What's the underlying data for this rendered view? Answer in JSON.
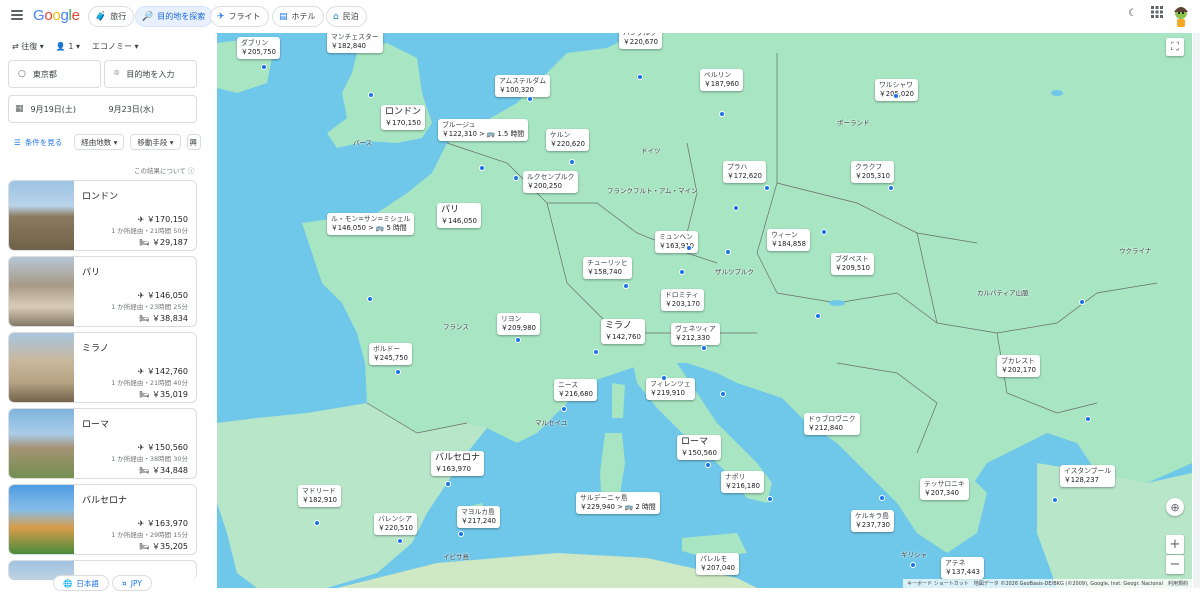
{
  "header": {
    "logo": "Google",
    "tabs": [
      {
        "label": "旅行",
        "icon": "suitcase-icon"
      },
      {
        "label": "目的地を探索",
        "icon": "explore-icon",
        "selected": true
      },
      {
        "label": "フライト",
        "icon": "plane-icon"
      },
      {
        "label": "ホテル",
        "icon": "hotel-icon"
      },
      {
        "label": "民泊",
        "icon": "house-icon"
      }
    ]
  },
  "search": {
    "trip_type": "往復",
    "passengers": "1",
    "cabin": "エコノミー",
    "origin": "東京都",
    "destination_placeholder": "目的地を入力",
    "depart": "9月19日(土)",
    "return": "9月23日(水)"
  },
  "filters": {
    "show_filters": "条件を見る",
    "stops": "経由地数",
    "transport": "移動手段",
    "interests": "興"
  },
  "about_results": "この結果について",
  "results": [
    {
      "name": "ロンドン",
      "flight": "￥170,150",
      "flight_detail": "1 か所経由・21時間 50分",
      "hotel": "￥29,187"
    },
    {
      "name": "パリ",
      "flight": "￥146,050",
      "flight_detail": "1 か所経由・23時間 25分",
      "hotel": "￥38,834"
    },
    {
      "name": "ミラノ",
      "flight": "￥142,760",
      "flight_detail": "1 か所経由・21時間 40分",
      "hotel": "￥35,019"
    },
    {
      "name": "ローマ",
      "flight": "￥150,560",
      "flight_detail": "1 か所経由・38時間 30分",
      "hotel": "￥34,848"
    },
    {
      "name": "バルセロナ",
      "flight": "￥163,970",
      "flight_detail": "1 か所経由・29時間 15分",
      "hotel": "￥35,205"
    }
  ],
  "footer": {
    "language": "日本語",
    "currency": "JPY"
  },
  "map": {
    "cities": [
      {
        "name": "ダブリン",
        "price": "￥205,750"
      },
      {
        "name": "マンチェスター",
        "price": "￥182,840"
      },
      {
        "name": "ハンブルク",
        "price": "￥220,670"
      },
      {
        "name": "アムステルダム",
        "price": "￥100,320"
      },
      {
        "name": "ベルリン",
        "price": "￥187,960"
      },
      {
        "name": "ワルシャワ",
        "price": "￥205,020"
      },
      {
        "name": "ロンドン",
        "price": "￥170,150",
        "big": true
      },
      {
        "name": "ブルージュ",
        "price": "￥122,310 > 🚌 1.5 時間"
      },
      {
        "name": "ケルン",
        "price": "￥220,620"
      },
      {
        "name": "プラハ",
        "price": "￥172,620"
      },
      {
        "name": "クラクフ",
        "price": "￥205,310"
      },
      {
        "name": "ルクセンブルク",
        "price": "￥200,250"
      },
      {
        "name": "パリ",
        "price": "￥146,050",
        "big": true
      },
      {
        "name": "ル・モン=サン=ミシェル",
        "price": "￥146,050 > 🚌 5 時間"
      },
      {
        "name": "ミュンヘン",
        "price": "￥163,910"
      },
      {
        "name": "ウィーン",
        "price": "￥184,858"
      },
      {
        "name": "ブダペスト",
        "price": "￥209,510"
      },
      {
        "name": "チューリッヒ",
        "price": "￥158,740"
      },
      {
        "name": "ドロミティ",
        "price": "￥203,170"
      },
      {
        "name": "リヨン",
        "price": "￥209,980"
      },
      {
        "name": "ミラノ",
        "price": "￥142,760",
        "big": true
      },
      {
        "name": "ヴェネツィア",
        "price": "￥212,330"
      },
      {
        "name": "ボルドー",
        "price": "￥245,750"
      },
      {
        "name": "ニース",
        "price": "￥216,680"
      },
      {
        "name": "フィレンツェ",
        "price": "￥219,910"
      },
      {
        "name": "ブカレスト",
        "price": "￥202,170"
      },
      {
        "name": "ドゥブロヴニク",
        "price": "￥212,840"
      },
      {
        "name": "ローマ",
        "price": "￥150,560",
        "big": true
      },
      {
        "name": "バルセロナ",
        "price": "￥163,970",
        "big": true
      },
      {
        "name": "ナポリ",
        "price": "￥216,180"
      },
      {
        "name": "マドリード",
        "price": "￥182,910"
      },
      {
        "name": "サルデーニャ島",
        "price": "￥229,940 > 🚌 2 時間"
      },
      {
        "name": "テッサロニキ",
        "price": "￥207,340"
      },
      {
        "name": "イスタンブール",
        "price": "￥128,237"
      },
      {
        "name": "バレンシア",
        "price": "￥220,510"
      },
      {
        "name": "マヨルカ島",
        "price": "￥217,240"
      },
      {
        "name": "ケルキラ島",
        "price": "￥237,730"
      },
      {
        "name": "パレルモ",
        "price": "￥207,040"
      },
      {
        "name": "アテネ",
        "price": "￥137,443"
      }
    ],
    "labels": [
      "ポーランド",
      "ドイツ",
      "ウクライナ",
      "フランス",
      "カルパティア山脈",
      "フランクフルト・アム・マイン",
      "ザルツブルク",
      "パース",
      "マルセイユ",
      "イビサ島",
      "ギリシャ"
    ],
    "attribution": "キーボード ショートカット　地図データ ©2026 GeoBasis-DE/BKG (©2009), Google, Inst. Geogr. Nacional　利用規約"
  },
  "colors": {
    "accent": "#1a73e8",
    "water": "#6fc8e9",
    "land": "#a7e5c3",
    "selected_chip_bg": "#e8f0fe"
  }
}
